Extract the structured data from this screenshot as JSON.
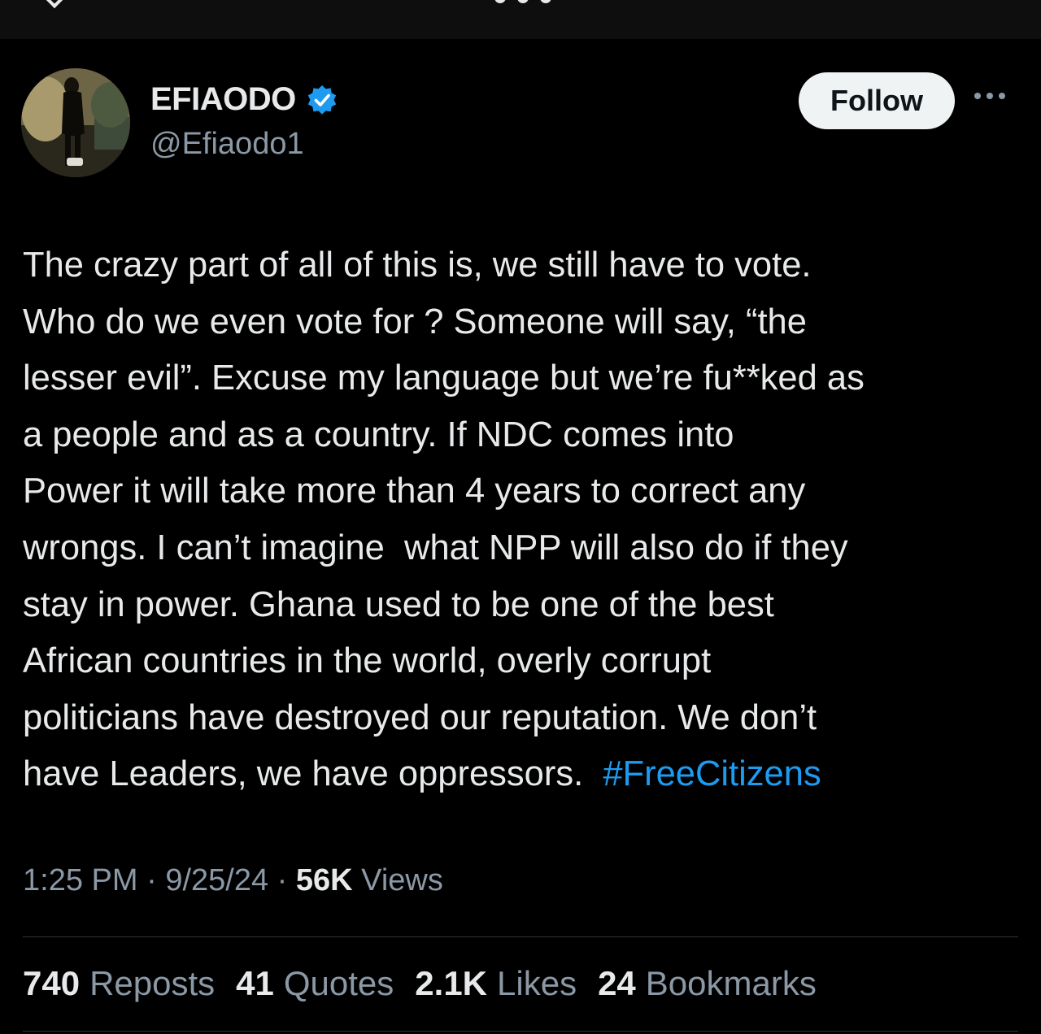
{
  "author": {
    "display_name": "EFIAODO",
    "handle": "@Efiaodo1",
    "verified_icon": "verified-badge-icon",
    "verified_color": "#1d9bf0"
  },
  "actions": {
    "follow_label": "Follow",
    "more_icon": "more-options-icon"
  },
  "tweet": {
    "lines": [
      "The crazy part of all of this is, we still have to vote.",
      "Who do we even vote for ? Someone will say, “the",
      "lesser evil”. Excuse my language but we’re fu**ked as",
      "a people and as a country. If NDC comes into",
      "Power it will take more than 4 years to correct any",
      "wrongs. I can’t imagine  what NPP will also do if they",
      "stay in power. Ghana used to be one of the best",
      "African countries in the world, overly corrupt",
      "politicians have destroyed our reputation. We don’t",
      "have Leaders, we have oppressors.  "
    ],
    "hashtag": "#FreeCitizens",
    "hashtag_color": "#1d9bf0"
  },
  "meta": {
    "time": "1:25 PM",
    "separator": " · ",
    "date": "9/25/24",
    "views_count": "56K",
    "views_label": "Views"
  },
  "stats": [
    {
      "count": "740",
      "label": "Reposts"
    },
    {
      "count": "41",
      "label": "Quotes"
    },
    {
      "count": "2.1K",
      "label": "Likes"
    },
    {
      "count": "24",
      "label": "Bookmarks"
    }
  ]
}
